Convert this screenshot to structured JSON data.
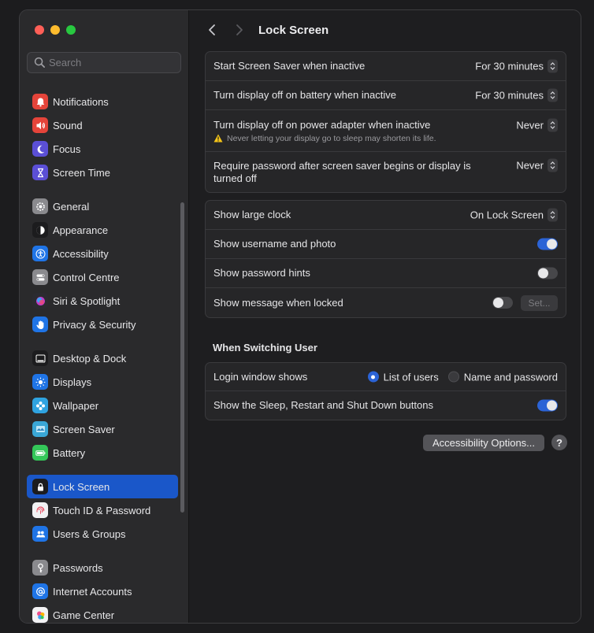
{
  "search": {
    "placeholder": "Search"
  },
  "sidebar": {
    "groups": [
      [
        {
          "label": "Notifications",
          "icon": "bell-icon",
          "color": "#e5443a"
        },
        {
          "label": "Sound",
          "icon": "speaker-icon",
          "color": "#e5443a"
        },
        {
          "label": "Focus",
          "icon": "moon-icon",
          "color": "#5b4fd6"
        },
        {
          "label": "Screen Time",
          "icon": "hourglass-icon",
          "color": "#5b4fd6"
        }
      ],
      [
        {
          "label": "General",
          "icon": "gear-icon",
          "color": "#8a8a8e"
        },
        {
          "label": "Appearance",
          "icon": "appearance-icon",
          "color": "#1c1c1e"
        },
        {
          "label": "Accessibility",
          "icon": "accessibility-icon",
          "color": "#1f74e6"
        },
        {
          "label": "Control Centre",
          "icon": "switches-icon",
          "color": "#8a8a8e"
        },
        {
          "label": "Siri & Spotlight",
          "icon": "siri-icon",
          "color": "#2b2b30"
        },
        {
          "label": "Privacy & Security",
          "icon": "hand-icon",
          "color": "#1f74e6"
        }
      ],
      [
        {
          "label": "Desktop & Dock",
          "icon": "dock-icon",
          "color": "#1c1c1e"
        },
        {
          "label": "Displays",
          "icon": "sun-icon",
          "color": "#1f74e6"
        },
        {
          "label": "Wallpaper",
          "icon": "flower-icon",
          "color": "#2fa3e0"
        },
        {
          "label": "Screen Saver",
          "icon": "screensaver-icon",
          "color": "#3aa7d6"
        },
        {
          "label": "Battery",
          "icon": "battery-icon",
          "color": "#34c759"
        }
      ],
      [
        {
          "label": "Lock Screen",
          "icon": "lock-icon",
          "color": "#1c1c1e",
          "active": true
        },
        {
          "label": "Touch ID & Password",
          "icon": "fingerprint-icon",
          "color": "#f2f2f4"
        },
        {
          "label": "Users & Groups",
          "icon": "users-icon",
          "color": "#1f74e6"
        }
      ],
      [
        {
          "label": "Passwords",
          "icon": "key-icon",
          "color": "#8a8a8e"
        },
        {
          "label": "Internet Accounts",
          "icon": "at-icon",
          "color": "#1f74e6"
        },
        {
          "label": "Game Center",
          "icon": "gamecenter-icon",
          "color": "#f2f2f4"
        }
      ]
    ]
  },
  "main": {
    "title": "Lock Screen",
    "card1": [
      {
        "label": "Start Screen Saver when inactive",
        "value": "For 30 minutes"
      },
      {
        "label": "Turn display off on battery when inactive",
        "value": "For 30 minutes"
      },
      {
        "label": "Turn display off on power adapter when inactive",
        "value": "Never",
        "sub": "Never letting your display go to sleep may shorten its life."
      },
      {
        "label": "Require password after screen saver begins or display is turned off",
        "value": "Never"
      }
    ],
    "card2": [
      {
        "label": "Show large clock",
        "value": "On Lock Screen"
      },
      {
        "label": "Show username and photo",
        "toggle": true
      },
      {
        "label": "Show password hints",
        "toggle": false
      },
      {
        "label": "Show message when locked",
        "toggle": false,
        "button": "Set..."
      }
    ],
    "section_title": "When Switching User",
    "card3": {
      "login_label": "Login window shows",
      "option1": "List of users",
      "option2": "Name and password",
      "selected": "List of users",
      "sleep_label": "Show the Sleep, Restart and Shut Down buttons",
      "sleep_toggle": true
    },
    "accessibility_button": "Accessibility Options...",
    "help_label": "?"
  }
}
